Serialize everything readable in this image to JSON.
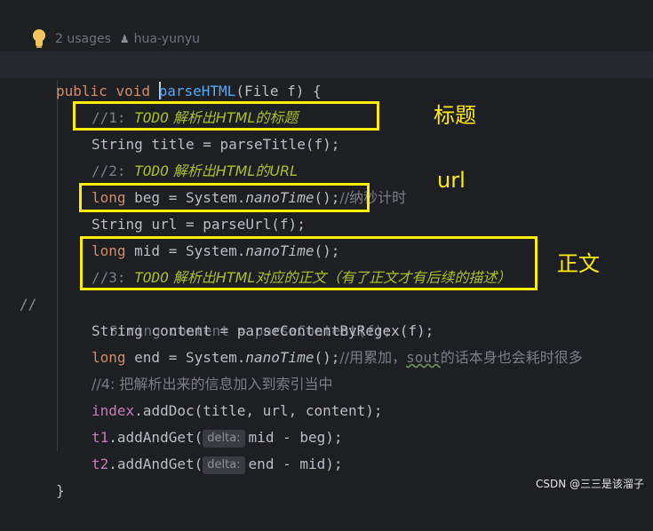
{
  "hint": {
    "usages": "2 usages",
    "author": "hua-yunyu"
  },
  "code": {
    "sig_kw1": "public",
    "sig_kw2": "void",
    "sig_name": "parseHTML",
    "sig_rest": "(File f) {",
    "c1_prefix": "//1: ",
    "c1_todo": "TODO",
    "c1_text": " 解析出HTML的标题",
    "l_title": "String title = parseTitle(f);",
    "c2_prefix": "//2: ",
    "c2_todo": "TODO",
    "c2_text": " 解析出HTML的URL",
    "beg_kw": "long",
    "beg_a": " beg = System.",
    "beg_fn": "nanoTime",
    "beg_b": "();",
    "beg_cmt": "//纳秒计时",
    "l_url": "String url = parseUrl(f);",
    "mid_kw": "long",
    "mid_a": " mid = System.",
    "mid_fn": "nanoTime",
    "mid_b": "();",
    "c3_prefix": "//3: ",
    "c3_todo": "TODO",
    "c3_text": " 解析出HTML对应的正文（有了正文才有后续的描述）",
    "gutter_slashes": "//",
    "l_content_old": "String content = parseContent(f);",
    "l_content": "String content = parseContentByRegex(f);",
    "end_kw": "long",
    "end_a": " end = System.",
    "end_fn": "nanoTime",
    "end_b": "();",
    "end_cmt1": "//用累加，",
    "end_cmt_sout": "sout",
    "end_cmt2": "的话本身也会耗时很多",
    "c4": "//4: 把解析出来的信息加入到索引当中",
    "idx_obj": "index",
    "idx_rest": ".addDoc(title, url, content);",
    "t1_obj": "t1",
    "t1_call": ".addAndGet(",
    "t1_hint": "delta:",
    "t1_args": "mid - beg);",
    "t2_obj": "t2",
    "t2_call": ".addAndGet(",
    "t2_hint": "delta:",
    "t2_args": "end - mid);",
    "close": "}"
  },
  "annotations": {
    "title": "标题",
    "url": "url",
    "content": "正文"
  },
  "watermark": "CSDN @三三是该溜子",
  "colors": {
    "highlight": "#ffee00",
    "keyword": "#cf8e6d",
    "function": "#56a8f5",
    "field": "#c77dbb",
    "todo": "#a8c023"
  }
}
